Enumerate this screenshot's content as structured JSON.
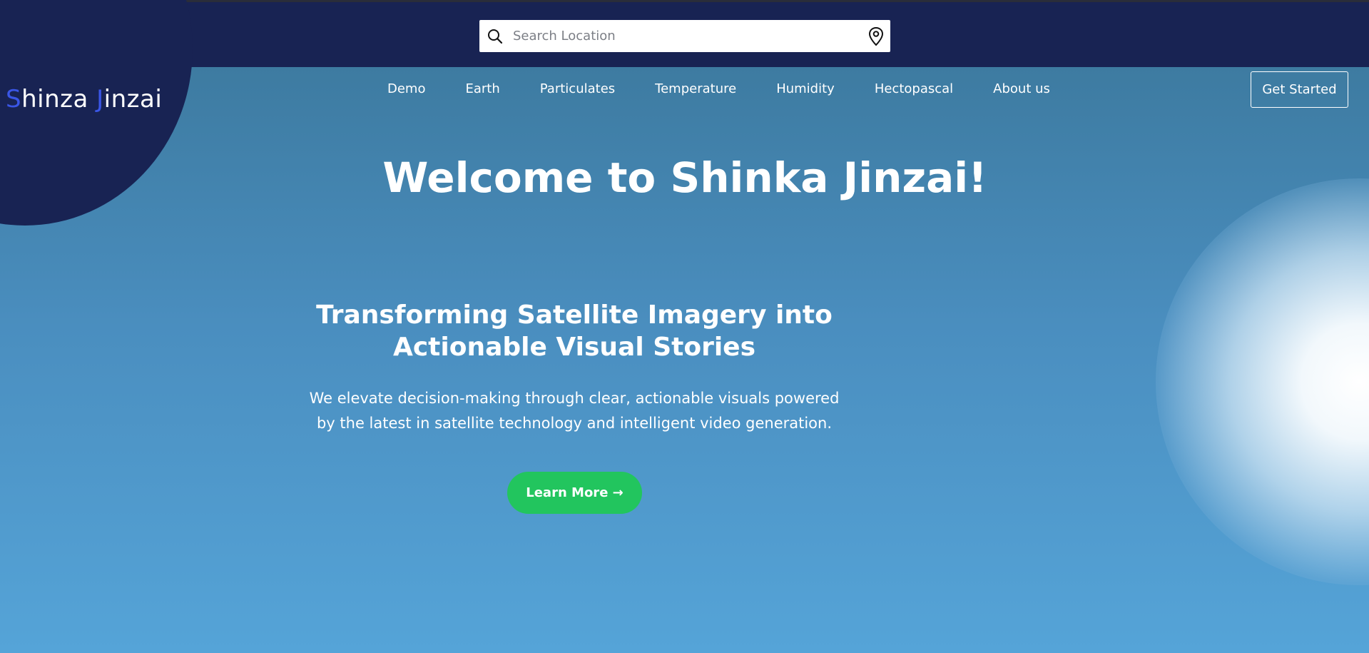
{
  "search": {
    "placeholder": "Search Location",
    "search_icon": "search-icon",
    "location_icon": "map-pin-icon"
  },
  "brand": {
    "logo_first_initial": "S",
    "logo_first_rest": "hinza ",
    "logo_second_initial": "J",
    "logo_second_rest": "inzai",
    "accent_color": "#3a56e6"
  },
  "nav": {
    "items": [
      {
        "label": "Demo"
      },
      {
        "label": "Earth"
      },
      {
        "label": "Particulates"
      },
      {
        "label": "Temperature"
      },
      {
        "label": "Humidity"
      },
      {
        "label": "Hectopascal"
      },
      {
        "label": "About us"
      }
    ],
    "cta_label": "Get Started"
  },
  "hero": {
    "title": "Welcome to Shinka Jinzai!",
    "subtitle": "Transforming Satellite Imagery into Actionable Visual Stories",
    "description": "We elevate decision-making through clear, actionable visuals powered by the latest in satellite technology and intelligent video generation.",
    "button_label": "Learn More →",
    "button_color": "#22c55e"
  },
  "colors": {
    "topbar": "#182353",
    "background_top": "#3a7699",
    "background_bottom": "#55a4d8"
  }
}
